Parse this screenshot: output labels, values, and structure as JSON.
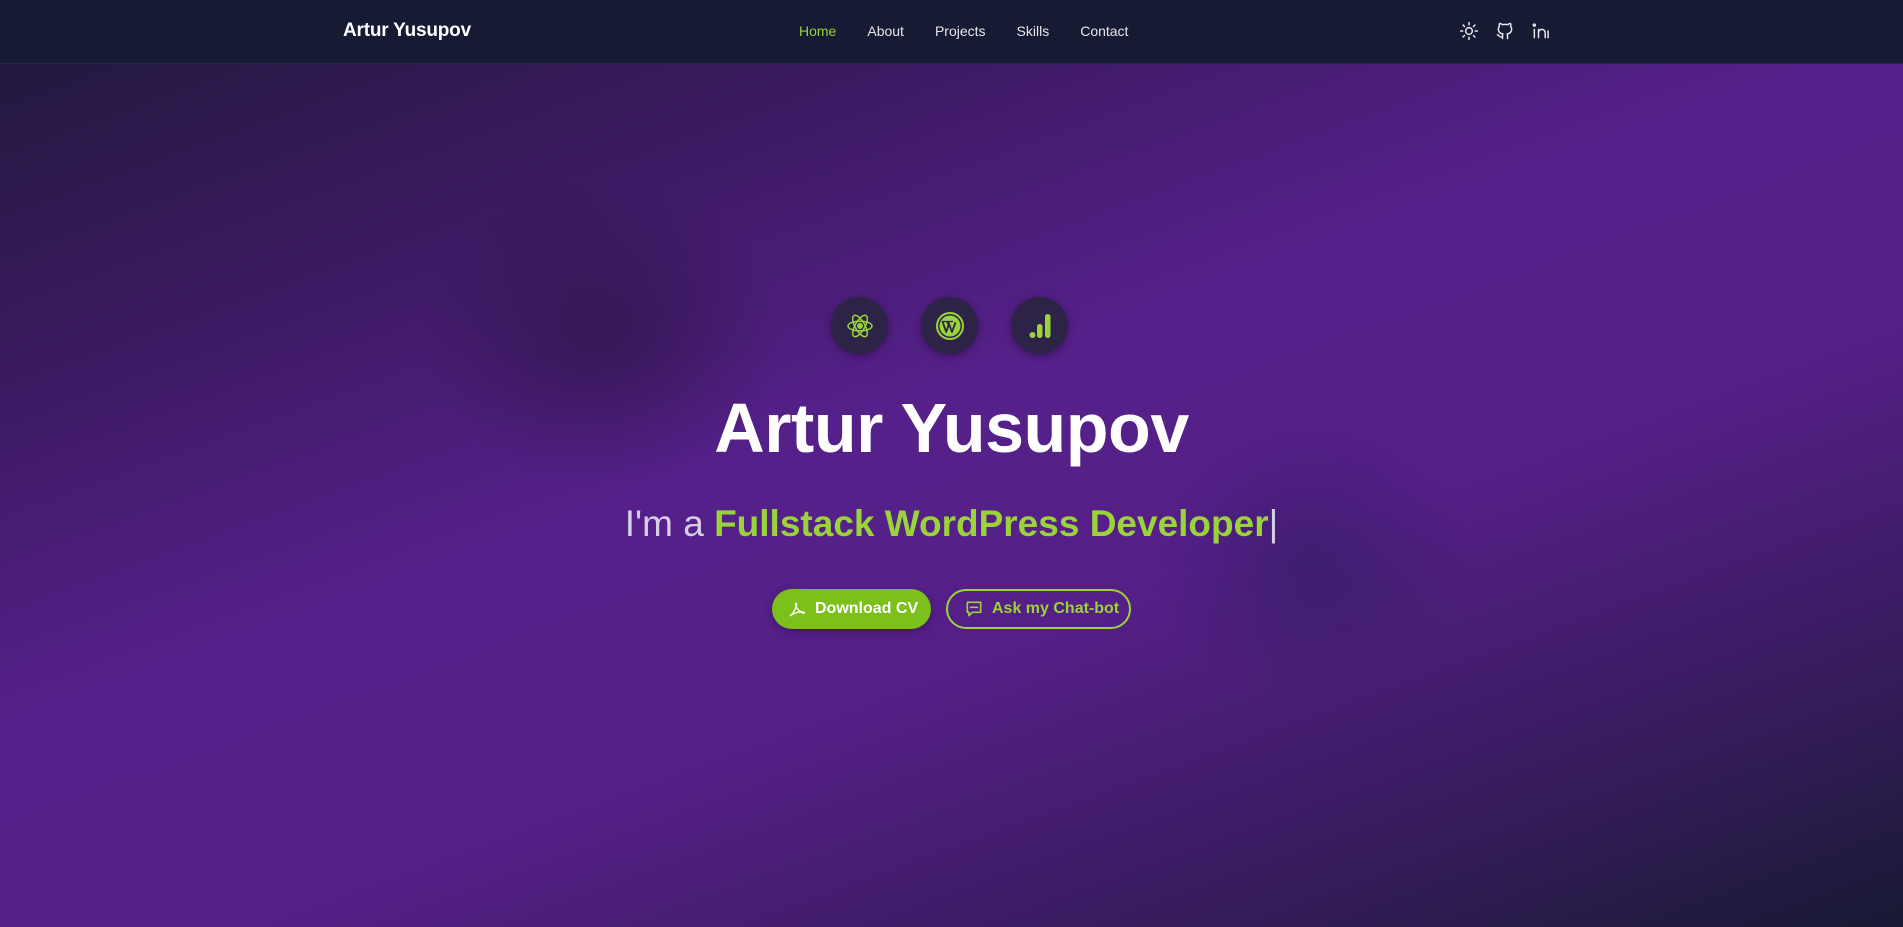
{
  "header": {
    "brand": "Artur Yusupov",
    "nav": [
      "Home",
      "About",
      "Projects",
      "Skills",
      "Contact"
    ],
    "active": "Home",
    "tools": [
      "sun-icon",
      "github-icon",
      "linkedin-icon"
    ]
  },
  "hero": {
    "tech_icons": [
      "react-icon",
      "wordpress-icon",
      "analytics-icon"
    ],
    "title": "Artur Yusupov",
    "subtitle_prefix": "I'm a",
    "subtitle_role": "Fullstack WordPress Developer",
    "cursor": "|",
    "buttons": {
      "download_cv": "Download CV",
      "chat_bot": "Ask my Chat-bot"
    }
  },
  "colors": {
    "accent": "#9ad33a",
    "accent_button": "#7cc01b",
    "nav_bg": "#171a33"
  }
}
